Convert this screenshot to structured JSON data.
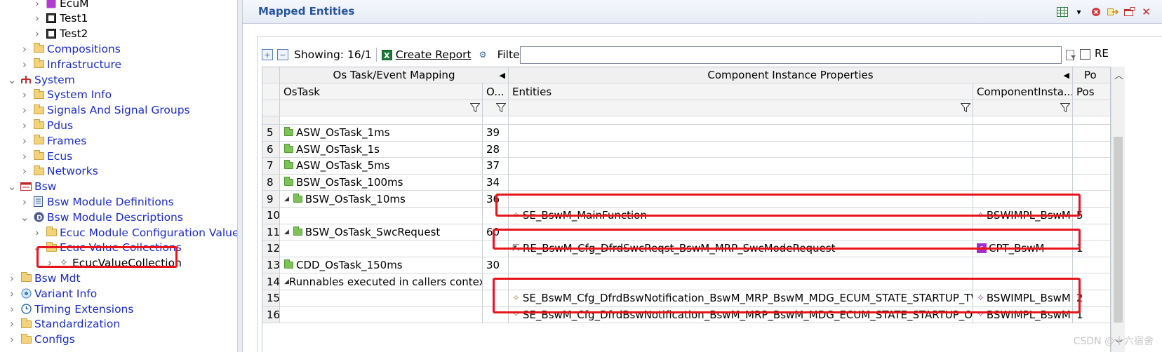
{
  "tree": {
    "items": [
      {
        "label": "EcuM",
        "icon": "ecu-icon",
        "depth": 3,
        "twisty": ">"
      },
      {
        "label": "Test1",
        "icon": "module-icon",
        "depth": 3,
        "twisty": ">"
      },
      {
        "label": "Test2",
        "icon": "module-icon",
        "depth": 3,
        "twisty": ">"
      },
      {
        "label": "Compositions",
        "icon": "folder-icon",
        "depth": 2,
        "twisty": ">"
      },
      {
        "label": "Infrastructure",
        "icon": "folder-icon",
        "depth": 2,
        "twisty": ">"
      },
      {
        "label": "System",
        "icon": "system-icon",
        "depth": 1,
        "twisty": "v"
      },
      {
        "label": "System Info",
        "icon": "folder-icon",
        "depth": 2,
        "twisty": ">"
      },
      {
        "label": "Signals And Signal Groups",
        "icon": "folder-icon",
        "depth": 2,
        "twisty": ">"
      },
      {
        "label": "Pdus",
        "icon": "folder-icon",
        "depth": 2,
        "twisty": ">"
      },
      {
        "label": "Frames",
        "icon": "folder-icon",
        "depth": 2,
        "twisty": ">"
      },
      {
        "label": "Ecus",
        "icon": "folder-icon",
        "depth": 2,
        "twisty": ">"
      },
      {
        "label": "Networks",
        "icon": "folder-icon",
        "depth": 2,
        "twisty": ">"
      },
      {
        "label": "Bsw",
        "icon": "bsw-icon",
        "depth": 1,
        "twisty": "v"
      },
      {
        "label": "Bsw Module Definitions",
        "icon": "definition-icon",
        "depth": 2,
        "twisty": ">"
      },
      {
        "label": "Bsw Module Descriptions",
        "icon": "description-icon",
        "depth": 2,
        "twisty": "v"
      },
      {
        "label": "Ecuc Module Configuration Values",
        "icon": "folder-icon",
        "depth": 3,
        "twisty": ">"
      },
      {
        "label": "Ecuc Value Collections",
        "icon": "folder-icon",
        "depth": 3,
        "twisty": "v"
      },
      {
        "label": "EcucValueCollection",
        "icon": "value-collection-icon",
        "depth": 4,
        "twisty": ">"
      },
      {
        "label": "Bsw Mdt",
        "icon": "folder-icon",
        "depth": 1,
        "twisty": ">"
      },
      {
        "label": "Variant Info",
        "icon": "variant-icon",
        "depth": 1,
        "twisty": ">"
      },
      {
        "label": "Timing Extensions",
        "icon": "timing-icon",
        "depth": 1,
        "twisty": ">"
      },
      {
        "label": "Standardization",
        "icon": "folder-icon",
        "depth": 1,
        "twisty": ">"
      },
      {
        "label": "Configs",
        "icon": "folder-icon",
        "depth": 1,
        "twisty": ">"
      }
    ]
  },
  "panel": {
    "title": "Mapped Entities"
  },
  "toolbar": {
    "showing": "Showing: 16/1",
    "create_report": "Create Report",
    "filter_label": "Filter :",
    "filter_value": "",
    "re_label": "RE"
  },
  "table": {
    "group_headers": [
      "Os Task/Event Mapping",
      "Component Instance Properties",
      "Po"
    ],
    "columns": [
      "OsTask",
      "O...",
      "Entities",
      "ComponentInsta...",
      "Pos"
    ],
    "rows": [
      {
        "num": "5",
        "task": "ASW_OsTask_1ms",
        "o": "39",
        "entity": "",
        "ci": "",
        "pos": "",
        "expand": ""
      },
      {
        "num": "6",
        "task": "ASW_OsTask_1s",
        "o": "28",
        "entity": "",
        "ci": "",
        "pos": "",
        "expand": ""
      },
      {
        "num": "7",
        "task": "ASW_OsTask_5ms",
        "o": "37",
        "entity": "",
        "ci": "",
        "pos": "",
        "expand": ""
      },
      {
        "num": "8",
        "task": "BSW_OsTask_100ms",
        "o": "34",
        "entity": "",
        "ci": "",
        "pos": "",
        "expand": ""
      },
      {
        "num": "9",
        "task": "BSW_OsTask_10ms",
        "o": "36",
        "entity": "",
        "ci": "",
        "pos": "",
        "expand": "◢"
      },
      {
        "num": "10",
        "task": "",
        "o": "",
        "entity": "SE_BswM_MainFunction",
        "ci": "BSWIMPL_BswM",
        "pos": "5",
        "expand": ""
      },
      {
        "num": "11",
        "task": "BSW_OsTask_SwcRequest",
        "o": "60",
        "entity": "",
        "ci": "",
        "pos": "",
        "expand": "◢"
      },
      {
        "num": "12",
        "task": "",
        "o": "",
        "entity": "RE_BswM_Cfg_DfrdSwcReqst_BswM_MRP_SwcModeRequest",
        "ci": "CPT_BswM",
        "pos": "1",
        "expand": ""
      },
      {
        "num": "13",
        "task": "CDD_OsTask_150ms",
        "o": "30",
        "entity": "",
        "ci": "",
        "pos": "",
        "expand": ""
      },
      {
        "num": "14",
        "task": "Runnables executed in callers context",
        "o": "",
        "entity": "",
        "ci": "",
        "pos": "",
        "expand": "◢"
      },
      {
        "num": "15",
        "task": "",
        "o": "",
        "entity": "SE_BswM_Cfg_DfrdBswNotification_BswM_MRP_BswM_MDG_ECUM_STATE_STARTUP_TWO",
        "ci": "BSWIMPL_BswM",
        "pos": "2",
        "expand": ""
      },
      {
        "num": "16",
        "task": "",
        "o": "",
        "entity": "SE_BswM_Cfg_DfrdBswNotification_BswM_MRP_BswM_MDG_ECUM_STATE_STARTUP_ONE",
        "ci": "BSWIMPL_BswM",
        "pos": "1",
        "expand": ""
      }
    ]
  },
  "watermark": "CSDN @十六宿舍",
  "colors": {
    "tree_link": "#1a2ccc",
    "panel_title": "#27569f",
    "highlight": "#e8141b"
  }
}
